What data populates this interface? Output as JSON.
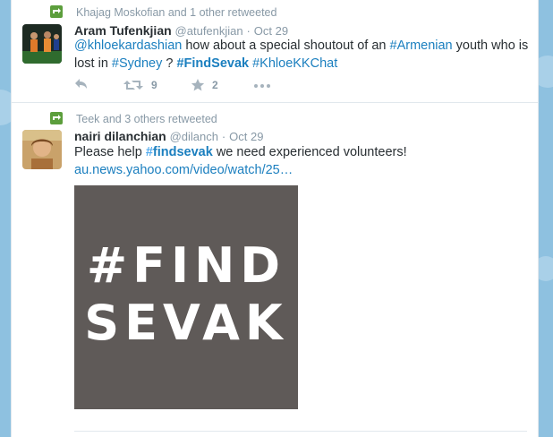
{
  "tweets": [
    {
      "retweet_line": "Khajag Moskofian and 1 other retweeted",
      "fullname": "Aram Tufenkjian",
      "handle": "@atufenkjian",
      "separator": "·",
      "time": "Oct 29",
      "text": {
        "mention": "@khloekardashian",
        "part1": " how about a special shoutout of an ",
        "hashtag1": "#Armenian",
        "part2": " youth who is lost in ",
        "hashtag2": "#Sydney",
        "part3": " ? ",
        "hashtag3": "#FindSevak",
        "part4": " ",
        "hashtag4": "#KhloeKKChat"
      },
      "retweet_count": "9",
      "favorite_count": "2"
    },
    {
      "retweet_line": "Teek and 3 others retweeted",
      "fullname": "nairi dilanchian",
      "handle": "@dilanch",
      "separator": "·",
      "time": "Oct 29",
      "text": {
        "part1": "Please help ",
        "hash_mark": "#",
        "hashtag_word": "findsevak",
        "part2": " we need experienced volunteers!",
        "link": "au.news.yahoo.com/video/watch/25…"
      },
      "media_line1": "#FIND",
      "media_line2": "SEVAK"
    }
  ],
  "colors": {
    "link": "#1b7fbf",
    "retweet_green": "#5c9e3c",
    "muted": "#8899a6",
    "page_bg": "#8ec1e0",
    "media_bg": "#5f5a58"
  }
}
